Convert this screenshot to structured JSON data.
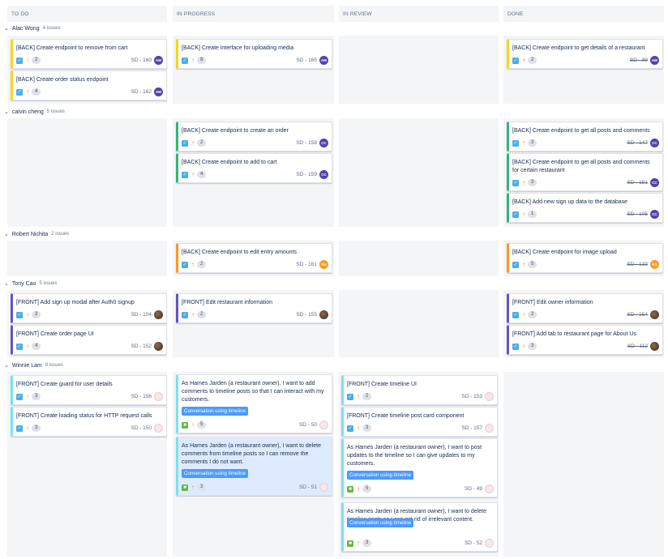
{
  "columns": [
    {
      "label": "TO DO"
    },
    {
      "label": "IN PROGRESS"
    },
    {
      "label": "IN REVIEW"
    },
    {
      "label": "DONE"
    }
  ],
  "swimlanes": [
    {
      "name": "Alac Wong",
      "count": "4 issues"
    },
    {
      "name": "calvin cheng",
      "count": "5 issues"
    },
    {
      "name": "Robert Nichita",
      "count": "2 issues"
    },
    {
      "name": "Tony Cao",
      "count": "5 issues"
    },
    {
      "name": "Winnie Lam",
      "count": "8 issues"
    }
  ],
  "epic_label": "Conversation using timeline",
  "colors": {
    "epic_yellow": "#f7d61c",
    "epic_green": "#36b37e",
    "epic_orange": "#ff991f",
    "epic_purple": "#6554c0",
    "epic_lightblue": "#79e2f2",
    "task_icon": "#4bade8",
    "story_icon": "#63ba3c",
    "epic_tag": "#4c9aff"
  },
  "cards": [
    {
      "title": "[BACK] Create endpoint to remove from cart",
      "type": "task",
      "priority": "medium",
      "points": "2",
      "key": "SD - 160",
      "avatar": "AW",
      "done": false
    },
    {
      "title": "[BACK] Create order status endpoint",
      "type": "task",
      "priority": "medium",
      "points": "4",
      "key": "SD - 162",
      "avatar": "AW",
      "done": false
    },
    {
      "title": "[BACK] Create interface for uploading media",
      "type": "task",
      "priority": "medium",
      "points": "8",
      "key": "SD - 165",
      "avatar": "AW",
      "done": false
    },
    {
      "title": "[BACK] Create endpoint to get details of a restaurant",
      "type": "task",
      "priority": "high",
      "points": "2",
      "key": "SD - 89",
      "avatar": "AW",
      "done": true
    },
    {
      "title": "[BACK] Create endpoint to create an order",
      "type": "task",
      "priority": "medium",
      "points": "2",
      "key": "SD - 158",
      "avatar": "CC",
      "done": false
    },
    {
      "title": "[BACK] Create endpoint to add to cart",
      "type": "task",
      "priority": "medium",
      "points": "4",
      "key": "SD - 159",
      "avatar": "CC",
      "done": false
    },
    {
      "title": "[BACK] Create endpoint to get all posts and comments",
      "type": "task",
      "priority": "medium",
      "points": "3",
      "key": "SD - 147",
      "avatar": "CC",
      "done": true
    },
    {
      "title": "[BACK] Create endpoint to get all posts and comments for certain restaurant",
      "type": "task",
      "priority": "medium",
      "points": "3",
      "key": "SD - 151",
      "avatar": "CC",
      "done": true
    },
    {
      "title": "[BACK] Add new sign up data to the database",
      "type": "task",
      "priority": "medium",
      "points": "1",
      "key": "SD - 105",
      "avatar": "CC",
      "done": true
    },
    {
      "title": "[BACK] Create endpoint to edit entry amounts",
      "type": "task",
      "priority": "medium",
      "points": "2",
      "key": "SD - 161",
      "avatar": "RN",
      "done": false
    },
    {
      "title": "[BACK] Create endpoint for image upload",
      "type": "task",
      "priority": "medium",
      "points": "5",
      "key": "SD - 133",
      "avatar": "RN",
      "done": true
    },
    {
      "title": "[FRONT] Add sign up modal after Auth0 signup",
      "type": "task",
      "priority": "medium",
      "points": "3",
      "key": "SD - 104",
      "avatar": "",
      "done": false
    },
    {
      "title": "[FRONT] Create order page UI",
      "type": "task",
      "priority": "medium",
      "points": "4",
      "key": "SD - 152",
      "avatar": "",
      "done": false
    },
    {
      "title": "[FRONT] Edit restaurant information",
      "type": "task",
      "priority": "medium",
      "points": "2",
      "key": "SD - 155",
      "avatar": "",
      "done": false
    },
    {
      "title": "[FRONT] Edit owner information",
      "type": "task",
      "priority": "medium",
      "points": "2",
      "key": "SD - 154",
      "avatar": "",
      "done": true
    },
    {
      "title": "[FRONT] Add tab to restaurant page for About Us",
      "type": "task",
      "priority": "medium",
      "points": "3",
      "key": "SD - 112",
      "avatar": "",
      "done": true
    },
    {
      "title": "[FRONT] Create guard for user details",
      "type": "task",
      "priority": "medium",
      "points": "3",
      "key": "SD - 156",
      "avatar": "",
      "done": false
    },
    {
      "title": "[FRONT] Create loading status for HTTP request calls",
      "type": "task",
      "priority": "medium",
      "points": "3",
      "key": "SD - 150",
      "avatar": "",
      "done": false
    },
    {
      "title": "As Hames Jarden (a restaurant owner), I want to add comments to timeline posts so that I can interact with my customers.",
      "type": "story",
      "priority": "medium",
      "points": "5",
      "key": "SD - 50",
      "avatar": "",
      "done": false
    },
    {
      "title": "As Hames Jarden (a restaurant owner), I want to delete comments from timeline posts so I can remove the comments I do not want.",
      "type": "story",
      "priority": "medium",
      "points": "3",
      "key": "SD - 51",
      "avatar": "",
      "done": false
    },
    {
      "title": "[FRONT] Create timeline UI",
      "type": "task",
      "priority": "medium",
      "points": "2",
      "key": "SD - 153",
      "avatar": "",
      "done": false
    },
    {
      "title": "[FRONT] Create timeline post card component",
      "type": "task",
      "priority": "medium",
      "points": "3",
      "key": "SD - 157",
      "avatar": "",
      "done": false
    },
    {
      "title": "As Hames Jarden (a restaurant owner), I want to post updates to the timeline so I can give updates to my customers.",
      "type": "story",
      "priority": "high",
      "points": "5",
      "key": "SD - 49",
      "avatar": "",
      "done": false
    },
    {
      "title": "As Hames Jarden (a restaurant owner), I want to delete timeline posts so I can get rid of irrelevant content.",
      "type": "story",
      "priority": "medium",
      "points": "3",
      "key": "SD - 52",
      "avatar": "",
      "done": false
    }
  ]
}
